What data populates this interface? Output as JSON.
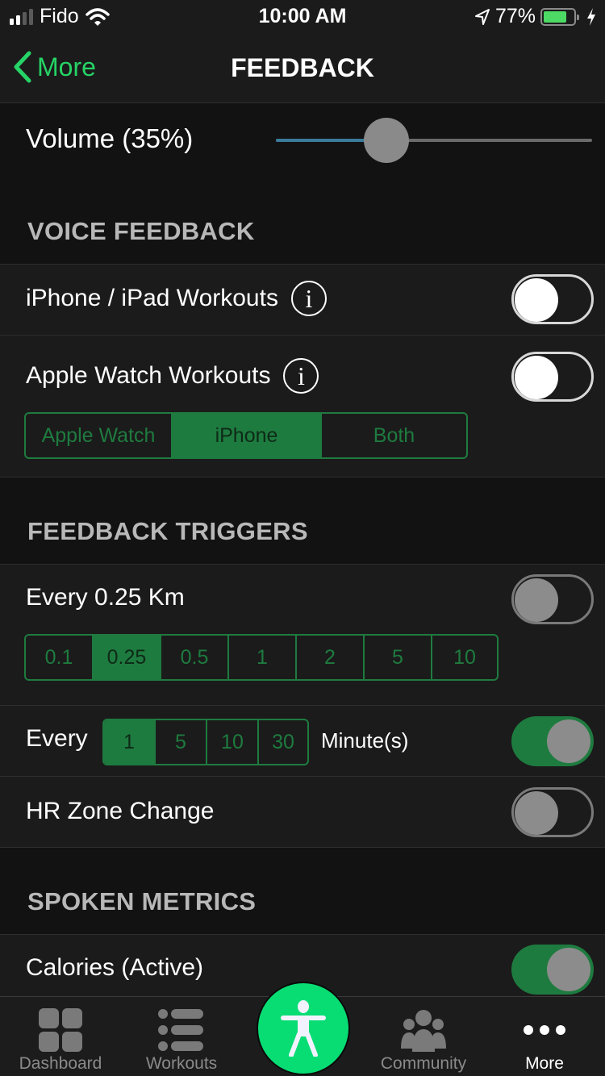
{
  "status_bar": {
    "carrier": "Fido",
    "time": "10:00 AM",
    "battery_percent": "77%",
    "battery_level": 0.77,
    "signal_bars_active": 2,
    "signal_bars_total": 4
  },
  "nav": {
    "back_label": "More",
    "title": "FEEDBACK"
  },
  "volume": {
    "label": "Volume (35%)",
    "value": 0.35
  },
  "sections": {
    "voice_feedback": {
      "header": "VOICE FEEDBACK",
      "iphone_ipad": {
        "label": "iPhone / iPad Workouts",
        "enabled": false
      },
      "apple_watch": {
        "label": "Apple Watch Workouts",
        "enabled": false,
        "device_options": [
          "Apple Watch",
          "iPhone",
          "Both"
        ],
        "selected_device": "iPhone"
      }
    },
    "feedback_triggers": {
      "header": "FEEDBACK TRIGGERS",
      "distance": {
        "label": "Every 0.25 Km",
        "enabled": false,
        "options": [
          "0.1",
          "0.25",
          "0.5",
          "1",
          "2",
          "5",
          "10"
        ],
        "selected": "0.25"
      },
      "time": {
        "prefix": "Every",
        "options": [
          "1",
          "5",
          "10",
          "30"
        ],
        "selected": "1",
        "suffix": "Minute(s)",
        "enabled": true
      },
      "hr_zone": {
        "label": "HR Zone Change",
        "enabled": false
      }
    },
    "spoken_metrics": {
      "header": "SPOKEN METRICS",
      "calories": {
        "label": "Calories (Active)",
        "enabled": true
      }
    }
  },
  "tab_bar": {
    "items": [
      {
        "label": "Dashboard",
        "icon": "dashboard-grid-icon"
      },
      {
        "label": "Workouts",
        "icon": "list-icon"
      },
      {
        "label": "",
        "icon": "person-figure-icon"
      },
      {
        "label": "Community",
        "icon": "group-icon"
      },
      {
        "label": "More",
        "icon": "ellipsis-icon",
        "active": true
      }
    ]
  },
  "colors": {
    "accent_green": "#26d366",
    "segment_green": "#1e7b3f",
    "center_button": "#08dd74",
    "slider_fill": "#3a7a9a"
  }
}
